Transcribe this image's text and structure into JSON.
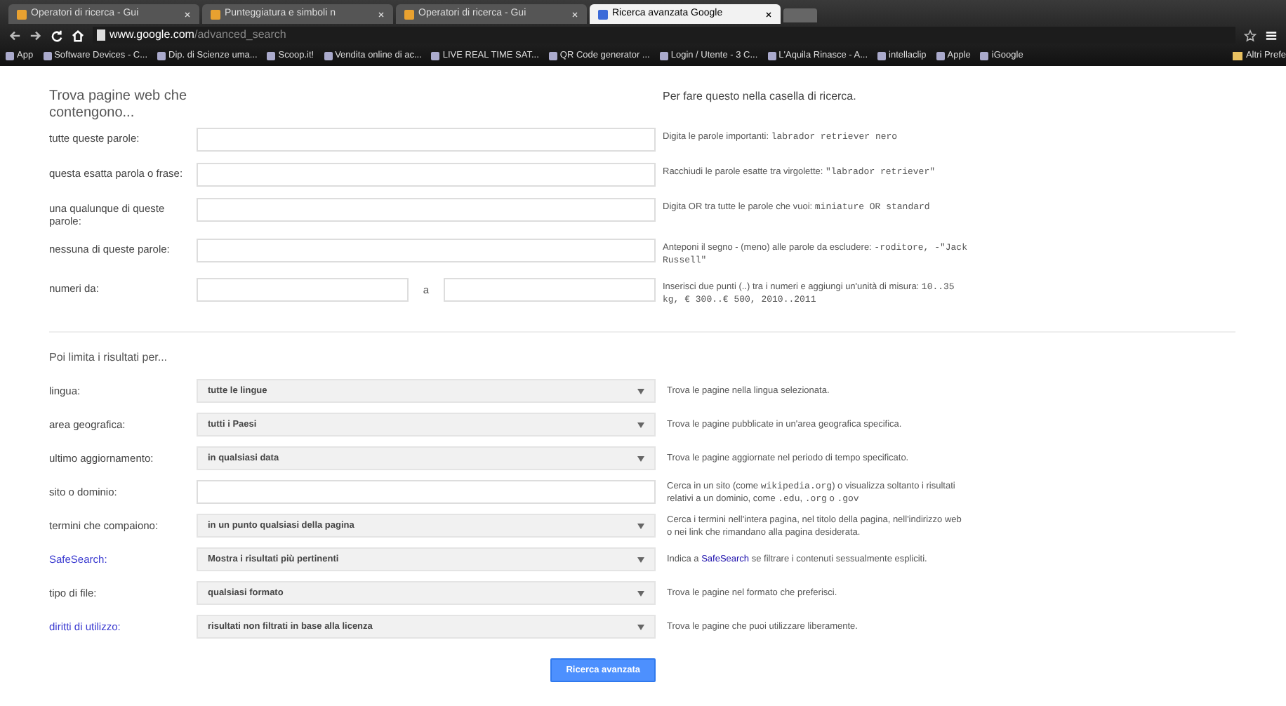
{
  "browser": {
    "tabs": [
      {
        "label": "Operatori di ricerca - Gui",
        "selected": false
      },
      {
        "label": "Punteggiatura e simboli n",
        "selected": false
      },
      {
        "label": "Operatori di ricerca - Gui",
        "selected": false
      },
      {
        "label": "Ricerca avanzata Google",
        "selected": true
      }
    ],
    "address": {
      "host": "www.google.com",
      "path": "/advanced_search"
    },
    "bookmarks": [
      "App",
      "Software Devices - C...",
      "Dip. di Scienze uma...",
      "Scoop.it!",
      "Vendita online di ac...",
      "LIVE REAL TIME SAT...",
      "QR Code generator ...",
      "Login / Utente - 3 C...",
      "L'Aquila Rinasce - A...",
      "intellaclip",
      "Apple",
      "iGoogle"
    ],
    "other_bookmarks": "Altri Prefe"
  },
  "find_section": {
    "title": "Trova pagine web che contengono...",
    "hint_title": "Per fare questo nella casella di ricerca.",
    "rows": [
      {
        "kind": "single",
        "label": "tutte queste parole:",
        "hint": [
          {
            "text": "Digita le parole importanti: ",
            "kind": "text"
          },
          {
            "text": "labrador retriever nero",
            "kind": "code"
          }
        ]
      },
      {
        "kind": "single",
        "label": "questa esatta parola o frase:",
        "hint": [
          {
            "text": "Racchiudi le parole esatte tra virgolette: ",
            "kind": "text"
          },
          {
            "text": "\"labrador retriever\"",
            "kind": "code"
          }
        ]
      },
      {
        "kind": "single",
        "label": "una qualunque di queste parole:",
        "hint": [
          {
            "text": "Digita OR tra tutte le parole che vuoi: ",
            "kind": "text"
          },
          {
            "text": "miniature OR standard",
            "kind": "code"
          }
        ]
      },
      {
        "kind": "single",
        "label": "nessuna di queste parole:",
        "hint": [
          {
            "text": "Anteponi il segno - (meno) alle parole da escludere: ",
            "kind": "text"
          },
          {
            "text": "-roditore, -\"Jack Russell\"",
            "kind": "code"
          }
        ]
      },
      {
        "kind": "range",
        "label": "numeri da:",
        "between": "a",
        "hint": [
          {
            "text": "Inserisci due punti (..) tra i numeri e aggiungi un'unità di misura: ",
            "kind": "text"
          },
          {
            "text": "10..35 kg, € 300..€ 500, 2010..2011",
            "kind": "code"
          }
        ]
      }
    ]
  },
  "limit_section": {
    "title": "Poi limita i risultati per...",
    "rows": [
      {
        "kind": "select",
        "label": "lingua:",
        "link": false,
        "value": "tutte le lingue",
        "hint": [
          {
            "text": "Trova le pagine nella lingua selezionata.",
            "kind": "text"
          }
        ]
      },
      {
        "kind": "select",
        "label": "area geografica:",
        "link": false,
        "value": "tutti i Paesi",
        "hint": [
          {
            "text": "Trova le pagine pubblicate in un'area geografica specifica.",
            "kind": "text"
          }
        ]
      },
      {
        "kind": "select",
        "label": "ultimo aggiornamento:",
        "link": false,
        "value": "in qualsiasi data",
        "hint": [
          {
            "text": "Trova le pagine aggiornate nel periodo di tempo specificato.",
            "kind": "text"
          }
        ]
      },
      {
        "kind": "input",
        "label": "sito o dominio:",
        "link": false,
        "hint": [
          {
            "text": "Cerca in un sito (come ",
            "kind": "text"
          },
          {
            "text": "wikipedia.org",
            "kind": "code"
          },
          {
            "text": ") o visualizza soltanto i risultati relativi a un dominio, come ",
            "kind": "text"
          },
          {
            "text": ".edu",
            "kind": "code"
          },
          {
            "text": ", ",
            "kind": "text"
          },
          {
            "text": ".org",
            "kind": "code"
          },
          {
            "text": " o ",
            "kind": "text"
          },
          {
            "text": ".gov",
            "kind": "code"
          }
        ]
      },
      {
        "kind": "select",
        "label": "termini che compaiono:",
        "link": false,
        "value": "in un punto qualsiasi della pagina",
        "hint": [
          {
            "text": "Cerca i termini nell'intera pagina, nel titolo della pagina, nell'indirizzo web o nei link che rimandano alla pagina desiderata.",
            "kind": "text"
          }
        ]
      },
      {
        "kind": "select",
        "label": "SafeSearch:",
        "link": true,
        "value": "Mostra i risultati più pertinenti",
        "hint": [
          {
            "text": "Indica a ",
            "kind": "text"
          },
          {
            "text": "SafeSearch",
            "kind": "link"
          },
          {
            "text": " se filtrare i contenuti sessualmente espliciti.",
            "kind": "text"
          }
        ]
      },
      {
        "kind": "select",
        "label": "tipo di file:",
        "link": false,
        "value": "qualsiasi formato",
        "hint": [
          {
            "text": "Trova le pagine nel formato che preferisci.",
            "kind": "text"
          }
        ]
      },
      {
        "kind": "select",
        "label": "diritti di utilizzo:",
        "link": true,
        "value": "risultati non filtrati in base alla licenza",
        "hint": [
          {
            "text": "Trova le pagine che puoi utilizzare liberamente.",
            "kind": "text"
          }
        ]
      }
    ]
  },
  "submit": "Ricerca avanzata"
}
